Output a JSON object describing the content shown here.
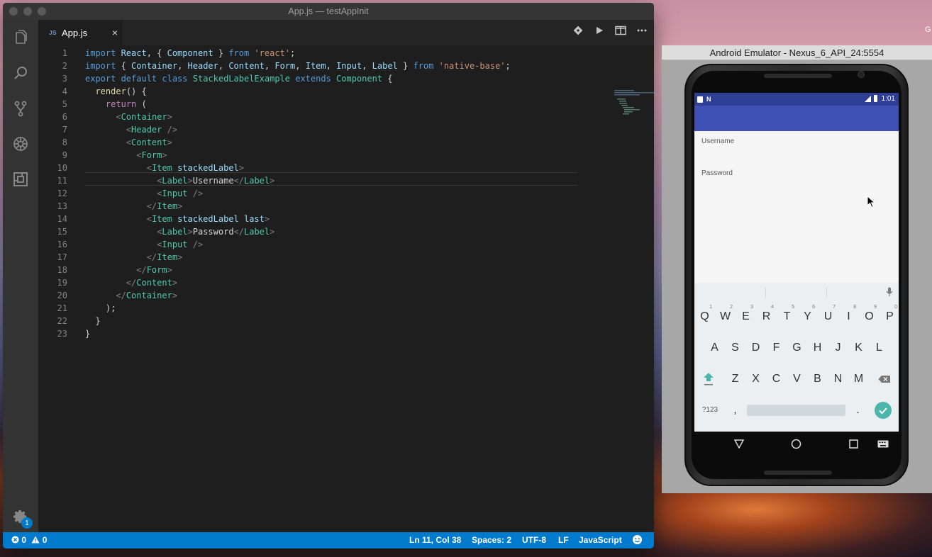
{
  "window": {
    "title": "App.js — testAppInit"
  },
  "tab": {
    "type": "JS",
    "label": "App.js",
    "close": "×"
  },
  "code_lines": [
    [
      [
        "kw",
        "import "
      ],
      [
        "var",
        "React"
      ],
      [
        "tx",
        ", { "
      ],
      [
        "var",
        "Component"
      ],
      [
        "tx",
        " } "
      ],
      [
        "kw",
        "from "
      ],
      [
        "str",
        "'react'"
      ],
      [
        "tx",
        ";"
      ]
    ],
    [
      [
        "kw",
        "import "
      ],
      [
        "tx",
        "{ "
      ],
      [
        "var",
        "Container"
      ],
      [
        "tx",
        ", "
      ],
      [
        "var",
        "Header"
      ],
      [
        "tx",
        ", "
      ],
      [
        "var",
        "Content"
      ],
      [
        "tx",
        ", "
      ],
      [
        "var",
        "Form"
      ],
      [
        "tx",
        ", "
      ],
      [
        "var",
        "Item"
      ],
      [
        "tx",
        ", "
      ],
      [
        "var",
        "Input"
      ],
      [
        "tx",
        ", "
      ],
      [
        "var",
        "Label"
      ],
      [
        "tx",
        " } "
      ],
      [
        "kw",
        "from "
      ],
      [
        "str",
        "'native-base'"
      ],
      [
        "tx",
        ";"
      ]
    ],
    [
      [
        "kw",
        "export default class "
      ],
      [
        "cls",
        "StackedLabelExample "
      ],
      [
        "kw",
        "extends "
      ],
      [
        "cls",
        "Component "
      ],
      [
        "tx",
        "{"
      ]
    ],
    [
      [
        "tx",
        "  "
      ],
      [
        "fn",
        "render"
      ],
      [
        "tx",
        "() {"
      ]
    ],
    [
      [
        "tx",
        "    "
      ],
      [
        "ctl",
        "return "
      ],
      [
        "tx",
        "("
      ]
    ],
    [
      [
        "tx",
        "      "
      ],
      [
        "br",
        "<"
      ],
      [
        "cls",
        "Container"
      ],
      [
        "br",
        ">"
      ]
    ],
    [
      [
        "tx",
        "        "
      ],
      [
        "br",
        "<"
      ],
      [
        "cls",
        "Header "
      ],
      [
        "br",
        "/>"
      ]
    ],
    [
      [
        "tx",
        "        "
      ],
      [
        "br",
        "<"
      ],
      [
        "cls",
        "Content"
      ],
      [
        "br",
        ">"
      ]
    ],
    [
      [
        "tx",
        "          "
      ],
      [
        "br",
        "<"
      ],
      [
        "cls",
        "Form"
      ],
      [
        "br",
        ">"
      ]
    ],
    [
      [
        "tx",
        "            "
      ],
      [
        "br",
        "<"
      ],
      [
        "cls",
        "Item "
      ],
      [
        "var",
        "stackedLabel"
      ],
      [
        "br",
        ">"
      ]
    ],
    [
      [
        "tx",
        "              "
      ],
      [
        "br",
        "<"
      ],
      [
        "cls",
        "Label"
      ],
      [
        "br",
        ">"
      ],
      [
        "tx",
        "Username"
      ],
      [
        "br",
        "</"
      ],
      [
        "cls",
        "Label"
      ],
      [
        "br",
        ">"
      ]
    ],
    [
      [
        "tx",
        "              "
      ],
      [
        "br",
        "<"
      ],
      [
        "cls",
        "Input "
      ],
      [
        "br",
        "/>"
      ]
    ],
    [
      [
        "tx",
        "            "
      ],
      [
        "br",
        "</"
      ],
      [
        "cls",
        "Item"
      ],
      [
        "br",
        ">"
      ]
    ],
    [
      [
        "tx",
        "            "
      ],
      [
        "br",
        "<"
      ],
      [
        "cls",
        "Item "
      ],
      [
        "var",
        "stackedLabel last"
      ],
      [
        "br",
        ">"
      ]
    ],
    [
      [
        "tx",
        "              "
      ],
      [
        "br",
        "<"
      ],
      [
        "cls",
        "Label"
      ],
      [
        "br",
        ">"
      ],
      [
        "tx",
        "Password"
      ],
      [
        "br",
        "</"
      ],
      [
        "cls",
        "Label"
      ],
      [
        "br",
        ">"
      ]
    ],
    [
      [
        "tx",
        "              "
      ],
      [
        "br",
        "<"
      ],
      [
        "cls",
        "Input "
      ],
      [
        "br",
        "/>"
      ]
    ],
    [
      [
        "tx",
        "            "
      ],
      [
        "br",
        "</"
      ],
      [
        "cls",
        "Item"
      ],
      [
        "br",
        ">"
      ]
    ],
    [
      [
        "tx",
        "          "
      ],
      [
        "br",
        "</"
      ],
      [
        "cls",
        "Form"
      ],
      [
        "br",
        ">"
      ]
    ],
    [
      [
        "tx",
        "        "
      ],
      [
        "br",
        "</"
      ],
      [
        "cls",
        "Content"
      ],
      [
        "br",
        ">"
      ]
    ],
    [
      [
        "tx",
        "      "
      ],
      [
        "br",
        "</"
      ],
      [
        "cls",
        "Container"
      ],
      [
        "br",
        ">"
      ]
    ],
    [
      [
        "tx",
        "    );"
      ]
    ],
    [
      [
        "tx",
        "  }"
      ]
    ],
    [
      [
        "tx",
        "}"
      ]
    ]
  ],
  "status": {
    "errors": "0",
    "warnings": "0",
    "position": "Ln 11, Col 38",
    "spaces": "Spaces: 2",
    "encoding": "UTF-8",
    "eol": "LF",
    "language": "JavaScript"
  },
  "activity": {
    "badge": "1"
  },
  "emulator": {
    "title": "Android Emulator - Nexus_6_API_24:5554",
    "time": "1:01",
    "fields": {
      "username_label": "Username",
      "password_label": "Password"
    },
    "keyboard": {
      "row1": [
        "Q",
        "W",
        "E",
        "R",
        "T",
        "Y",
        "U",
        "I",
        "O",
        "P"
      ],
      "row1_hints": [
        "1",
        "2",
        "3",
        "4",
        "5",
        "6",
        "7",
        "8",
        "9",
        "0"
      ],
      "row2": [
        "A",
        "S",
        "D",
        "F",
        "G",
        "H",
        "J",
        "K",
        "L"
      ],
      "row3": [
        "Z",
        "X",
        "C",
        "V",
        "B",
        "N",
        "M"
      ],
      "symbols": "?123",
      "comma": ",",
      "period": "."
    }
  },
  "desktop": {
    "edge_letter": "G"
  }
}
